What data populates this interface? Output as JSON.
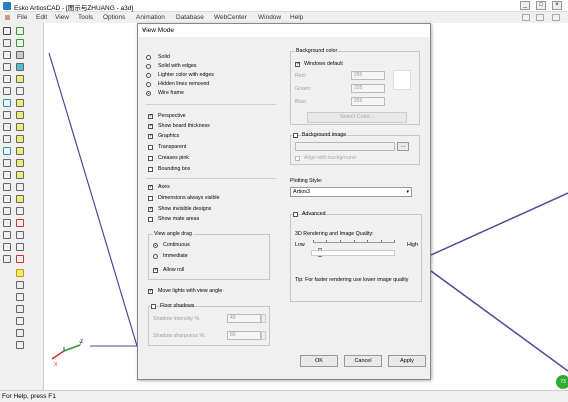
{
  "app": {
    "title": "Esko ArtiosCAD - [图示与ZHUANG - a3d]",
    "min_label": "_",
    "max_label": "□",
    "close_label": "×"
  },
  "menu": [
    "File",
    "Edit",
    "View",
    "Tools",
    "Options",
    "Animation",
    "Database",
    "WebCenter",
    "Window",
    "Help"
  ],
  "status": {
    "text": "For Help, press F1"
  },
  "axes": {
    "z": "Z",
    "y": "Y",
    "x": "X"
  },
  "colors": {
    "line": "#4a4a9a",
    "accent": "#2a7dc1"
  },
  "dialog": {
    "title": "View Mode",
    "close": "×",
    "render_modes": [
      {
        "label": "Solid",
        "checked": false
      },
      {
        "label": "Solid with edges",
        "checked": false
      },
      {
        "label": "Lighter color with edges",
        "checked": false
      },
      {
        "label": "Hidden lines removed",
        "checked": false
      },
      {
        "label": "Wire frame",
        "checked": true
      }
    ],
    "options1": [
      {
        "label": "Perspective",
        "checked": true
      },
      {
        "label": "Show board thickness",
        "checked": true
      },
      {
        "label": "Graphics",
        "checked": true
      },
      {
        "label": "Transparent",
        "checked": false
      },
      {
        "label": "Creases pink",
        "checked": false
      },
      {
        "label": "Bounding box",
        "checked": false
      }
    ],
    "options2": [
      {
        "label": "Axes",
        "checked": true
      },
      {
        "label": "Dimensions always visible",
        "checked": false
      },
      {
        "label": "Show invisible designs",
        "checked": true
      },
      {
        "label": "Show mate areas",
        "checked": false
      }
    ],
    "view_angle": {
      "label": "View angle drag",
      "modes": [
        {
          "label": "Continuous",
          "checked": true
        },
        {
          "label": "Immediate",
          "checked": false
        }
      ],
      "allow_roll": {
        "label": "Allow roll",
        "checked": true
      }
    },
    "move_lights": {
      "label": "Move lights with view angle",
      "checked": true
    },
    "floor_shadows": {
      "label": "Floor shadows",
      "checked": false,
      "intensity_label": "Shadow intensity %:",
      "intensity_value": "40",
      "sharpness_label": "Shadow sharpness %:",
      "sharpness_value": "80"
    },
    "background": {
      "label": "Background color",
      "windows_default": {
        "label": "Windows default",
        "checked": true
      },
      "red_label": "Red:",
      "red": "255",
      "green_label": "Green:",
      "green": "255",
      "blue_label": "Blue:",
      "blue": "255",
      "select_color": "Select Color...",
      "image": {
        "label": "Background image",
        "checked": false
      },
      "browse": "...",
      "align_label": "Align with background"
    },
    "plotting": {
      "label": "Plotting Style:",
      "value": "Artios3"
    },
    "advanced": {
      "label": "Advanced",
      "checked": false,
      "quality_label": "3D Rendering and Image Quality:",
      "low": "Low",
      "high": "High",
      "quality_level": 0.08,
      "tip": "Tip: For faster rendering use lower image quality"
    },
    "buttons": {
      "ok": "OK",
      "cancel": "Cancel",
      "apply": "Apply"
    }
  }
}
